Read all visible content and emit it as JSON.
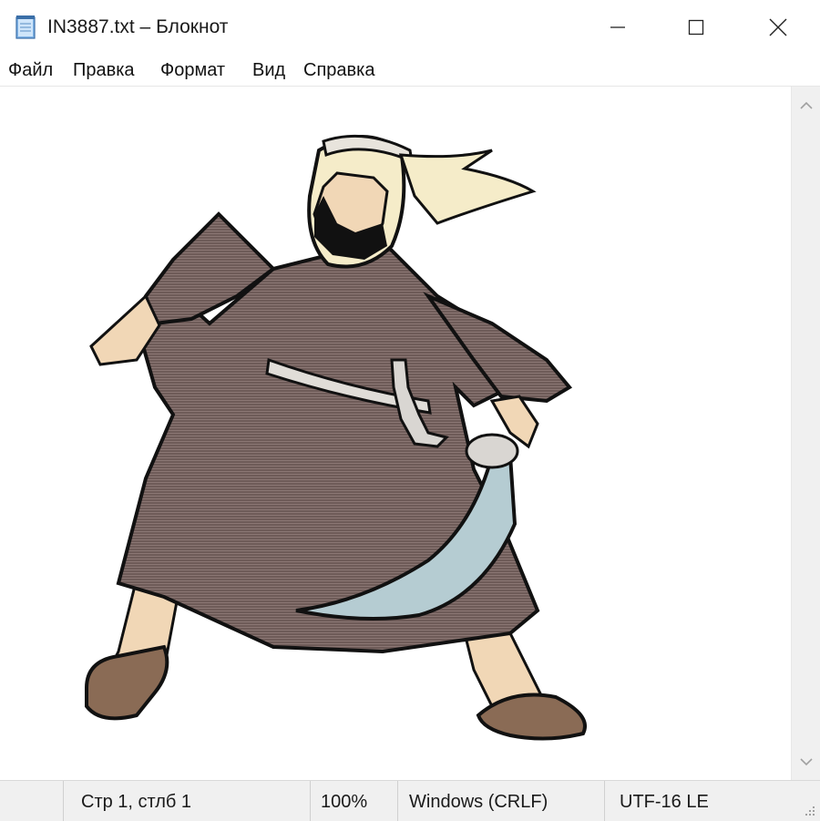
{
  "window": {
    "title": "IN3887.txt – Блокнот",
    "controls": [
      "minimize",
      "maximize",
      "close"
    ]
  },
  "menu": {
    "items": [
      "Файл",
      "Правка",
      "Формат",
      "Вид",
      "Справка"
    ]
  },
  "editor": {
    "content_icon": "ascii-art-bedouin-warrior-with-sword"
  },
  "status": {
    "position": "Стр 1, стлб 1",
    "zoom": "100%",
    "line_endings": "Windows (CRLF)",
    "encoding": "UTF-16 LE"
  },
  "colors": {
    "robe": "#6e5b58",
    "headdress": "#f5ecc9",
    "skin": "#f1d7b6",
    "blade": "#b5ccd2",
    "outline": "#111111"
  }
}
